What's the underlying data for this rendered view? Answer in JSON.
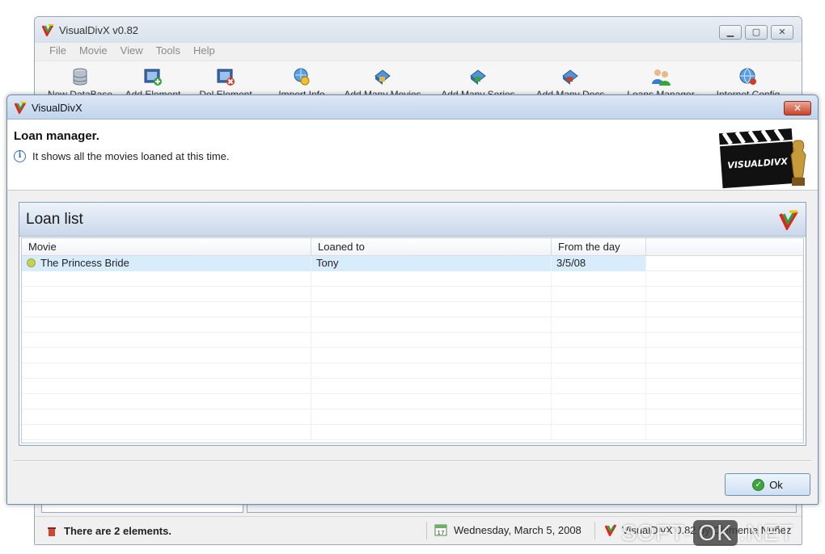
{
  "main_window": {
    "title": "VisualDivX v0.82",
    "menu": [
      "File",
      "Movie",
      "View",
      "Tools",
      "Help"
    ],
    "toolbar": [
      {
        "label": "New DataBase",
        "icon": "database-icon"
      },
      {
        "label": "Add Element",
        "icon": "add-element-icon"
      },
      {
        "label": "Del Element",
        "icon": "delete-element-icon"
      },
      {
        "label": "Import Info",
        "icon": "import-info-icon"
      },
      {
        "label": "Add Many Movies",
        "icon": "add-movies-icon"
      },
      {
        "label": "Add Many Series",
        "icon": "add-series-icon"
      },
      {
        "label": "Add Many Docs",
        "icon": "add-docs-icon"
      },
      {
        "label": "Loans Manager",
        "icon": "loans-manager-icon"
      },
      {
        "label": "Internet Config",
        "icon": "internet-config-icon"
      }
    ],
    "status": {
      "elements_text": "There are  2 elements.",
      "date": "Wednesday, March 5, 2008",
      "version": "VisualDivX 0.82 by Clemente Nuñez"
    }
  },
  "dialog": {
    "title": "VisualDivX",
    "close_label": "✕",
    "heading": "Loan manager.",
    "subtitle": "It shows all the movies loaned at this time.",
    "logo_text": "VISUALDIVX",
    "panel_title": "Loan list",
    "columns": [
      "Movie",
      "Loaned to",
      "From the day"
    ],
    "rows": [
      {
        "movie": "The Princess Bride",
        "loaned_to": "Tony",
        "from_day": "3/5/08"
      }
    ],
    "ok_label": "Ok"
  },
  "watermark": {
    "left": "SOFT-",
    "mid": "OK",
    "right": ".NET"
  },
  "colors": {
    "accent": "#2f6fb5",
    "selection": "#d9ecfb",
    "close": "#c8442a"
  }
}
